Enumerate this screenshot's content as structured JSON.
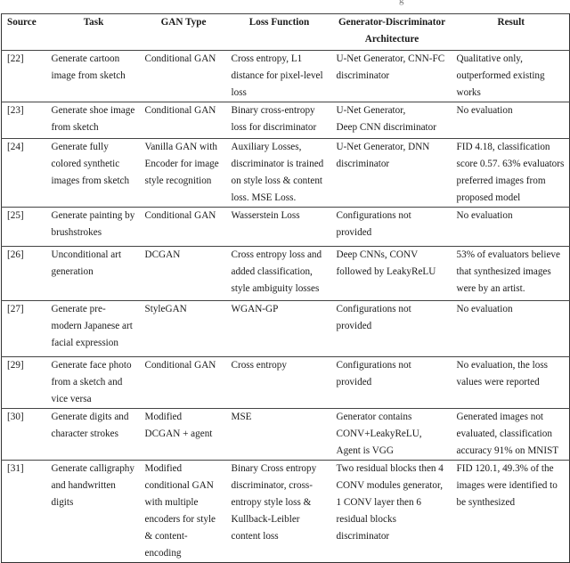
{
  "caption_fragment": "g",
  "table": {
    "headers": [
      "Source",
      "Task",
      "GAN Type",
      "Loss Function",
      "Generator-Discriminator\nArchitecture",
      "Result"
    ],
    "rows": [
      {
        "source": "[22]",
        "task": "Generate cartoon\nimage from sketch",
        "gan_type": "Conditional GAN",
        "loss": "Cross entropy, L1\ndistance for pixel-level\nloss",
        "architecture": "U-Net Generator, CNN-FC\ndiscriminator",
        "result": "Qualitative only,\noutperformed existing\nworks"
      },
      {
        "source": "[23]",
        "task": "Generate shoe image\nfrom sketch",
        "gan_type": "Conditional GAN",
        "loss": "Binary cross-entropy\nloss for discriminator",
        "architecture": "U-Net Generator,\nDeep CNN discriminator",
        "result": "No evaluation"
      },
      {
        "source": "[24]",
        "task": "Generate fully\ncolored synthetic\nimages from sketch",
        "gan_type": "Vanilla GAN with\nEncoder for image\nstyle recognition",
        "loss": "Auxiliary Losses,\ndiscriminator is trained\non style loss & content\nloss. MSE Loss.",
        "architecture": "U-Net Generator, DNN\ndiscriminator",
        "result": "FID 4.18, classification\nscore 0.57. 63% evaluators\npreferred images from\nproposed model"
      },
      {
        "source": "[25]",
        "task": "Generate painting by\nbrushstrokes",
        "gan_type": "Conditional GAN",
        "loss": "Wasserstein Loss",
        "architecture": "Configurations not\nprovided",
        "result": "No evaluation"
      },
      {
        "source": "[26]",
        "task": "Unconditional art\ngeneration",
        "gan_type": "DCGAN",
        "loss": "Cross entropy loss and\nadded classification,\nstyle ambiguity losses",
        "architecture": "Deep CNNs, CONV\nfollowed by LeakyReLU",
        "result": "53% of evaluators believe\nthat synthesized images\nwere by an artist."
      },
      {
        "source": "[27]",
        "task": "Generate pre-\nmodern Japanese art\nfacial expression",
        "gan_type": "StyleGAN",
        "loss": "WGAN-GP",
        "architecture": "Configurations not\nprovided",
        "result": "No evaluation"
      },
      {
        "source": "[29]",
        "task": "Generate face photo\nfrom a sketch and\nvice versa",
        "gan_type": "Conditional GAN",
        "loss": "Cross entropy",
        "architecture": "Configurations not\nprovided",
        "result": "No evaluation, the loss\nvalues were reported"
      },
      {
        "source": "[30]",
        "task": "Generate digits and\ncharacter strokes",
        "gan_type": "Modified\nDCGAN + agent",
        "loss": "MSE",
        "architecture": "Generator contains\nCONV+LeakyReLU,\nAgent is VGG",
        "result": "Generated images not\nevaluated, classification\naccuracy 91% on MNIST"
      },
      {
        "source": "[31]",
        "task": "Generate calligraphy\nand handwritten\ndigits",
        "gan_type": "Modified\nconditional GAN\nwith multiple\nencoders for style\n& content-\nencoding",
        "loss": "Binary Cross entropy\ndiscriminator, cross-\nentropy style loss &\nKullback-Leibler\ncontent loss",
        "architecture": "Two residual blocks then 4\nCONV modules generator,\n1 CONV layer then 6\nresidual blocks\ndiscriminator",
        "result": "FID 120.1, 49.3% of the\nimages were identified to\nbe synthesized"
      }
    ]
  }
}
